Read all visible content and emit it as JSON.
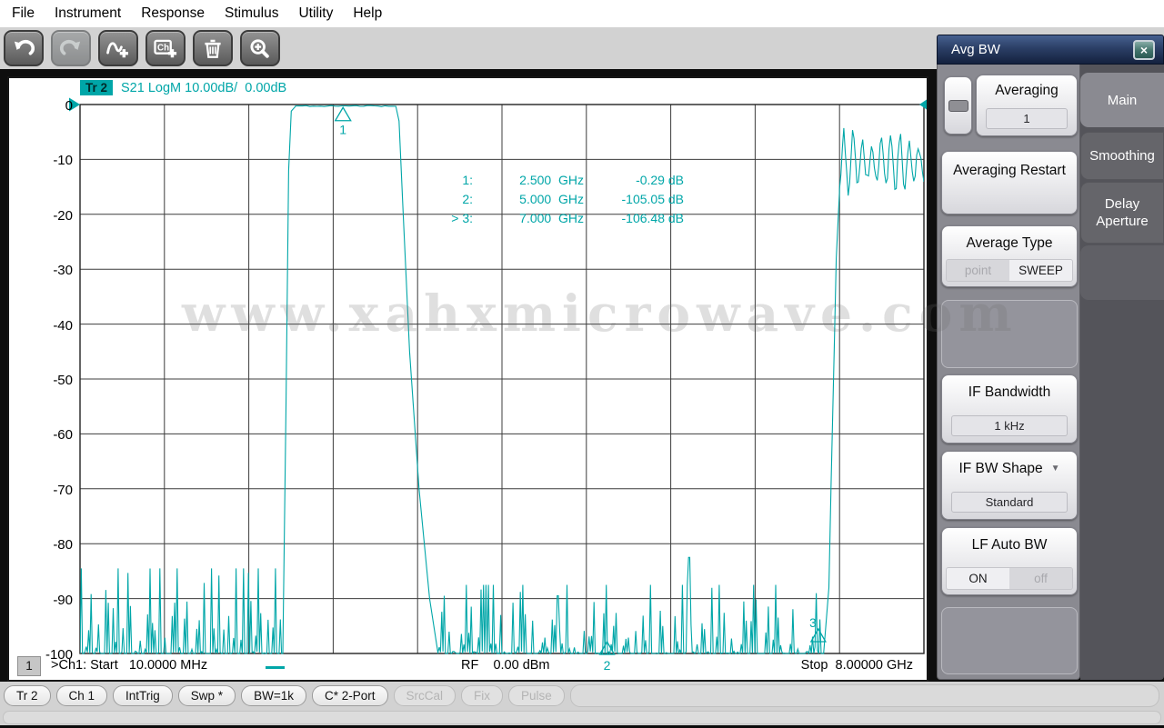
{
  "colors": {
    "trace": "#00A6A8",
    "panel_title_bar": "#2B3F66",
    "panel_body": "#8A8A91",
    "tab_unselected": "#65656A",
    "plot_background": "#FFFFFF",
    "app_dark_background": "#0E0E0E",
    "chrome_background": "#D2D2D2"
  },
  "menu": {
    "items": [
      "File",
      "Instrument",
      "Response",
      "Stimulus",
      "Utility",
      "Help"
    ]
  },
  "toolbar": {
    "buttons": [
      {
        "icon": "undo-icon",
        "enabled": true
      },
      {
        "icon": "redo-icon",
        "enabled": false
      },
      {
        "icon": "add-trace-icon",
        "enabled": true
      },
      {
        "icon": "add-channel-icon",
        "enabled": true
      },
      {
        "icon": "delete-icon",
        "enabled": true
      },
      {
        "icon": "zoom-icon",
        "enabled": true
      }
    ]
  },
  "plot": {
    "trace_badge": "Tr 2",
    "trace_title": "S21 LogM 10.00dB/  0.00dB",
    "y_axis_labels": [
      "0",
      "-10",
      "-20",
      "-30",
      "-40",
      "-50",
      "-60",
      "-70",
      "-80",
      "-90",
      "-100"
    ],
    "marker_rows": [
      {
        "id": "1:",
        "freq": "2.500  GHz",
        "value": "-0.29 dB"
      },
      {
        "id": "2:",
        "freq": "5.000  GHz",
        "value": "-105.05 dB"
      },
      {
        "id": "> 3:",
        "freq": "7.000  GHz",
        "value": "-106.48 dB"
      }
    ],
    "footer": {
      "channel_badge": "1",
      "start": ">Ch1: Start   10.0000 MHz",
      "rf": "RF    0.00 dBm",
      "stop": "Stop  8.00000 GHz"
    },
    "watermark": "www.xahxmicrowave.com"
  },
  "chart_data": {
    "type": "line",
    "title": "S21 LogM bandpass filter response",
    "x_unit": "GHz",
    "y_unit": "dB",
    "x_range": [
      0.01,
      8.0
    ],
    "y_range": [
      -100,
      0
    ],
    "x_divisions": 10,
    "y_divisions": 10,
    "scale_per_division_db": 10.0,
    "reference_level_db": 0.0,
    "markers": [
      {
        "id": "1",
        "freq_ghz": 2.5,
        "value_db": -0.29,
        "active": false
      },
      {
        "id": "2",
        "freq_ghz": 5.0,
        "value_db": -105.05,
        "active": false
      },
      {
        "id": "3",
        "freq_ghz": 7.0,
        "value_db": -106.48,
        "active": true
      }
    ],
    "trace": {
      "name": "S21",
      "segments": [
        {
          "type": "noise",
          "f0": 0.01,
          "f1": 1.93,
          "base_db": -100.8,
          "spike_db": -86
        },
        {
          "type": "edge",
          "points": [
            [
              1.93,
              -100
            ],
            [
              1.96,
              -55
            ],
            [
              1.985,
              -12
            ],
            [
              2.01,
              -1.2
            ],
            [
              2.05,
              -0.35
            ]
          ]
        },
        {
          "type": "flat",
          "f0": 2.05,
          "f1": 3.0,
          "db": -0.29,
          "ripple_db": 0.2
        },
        {
          "type": "edge",
          "points": [
            [
              3.0,
              -0.35
            ],
            [
              3.03,
              -3
            ],
            [
              3.07,
              -20
            ],
            [
              3.13,
              -45
            ],
            [
              3.22,
              -70
            ],
            [
              3.32,
              -90
            ],
            [
              3.4,
              -100
            ]
          ]
        },
        {
          "type": "noise",
          "f0": 3.4,
          "f1": 7.05,
          "base_db": -100.8,
          "spike_db": -89,
          "spurs": [
            {
              "f": 5.78,
              "db": -82.5
            },
            {
              "f": 4.53,
              "db": -89.5
            },
            {
              "f": 6.98,
              "db": -89
            }
          ]
        },
        {
          "type": "edge",
          "points": [
            [
              7.05,
              -100
            ],
            [
              7.1,
              -88
            ],
            [
              7.12,
              -70
            ],
            [
              7.15,
              -45
            ],
            [
              7.17,
              -28
            ],
            [
              7.2,
              -16
            ]
          ]
        },
        {
          "type": "ripple",
          "f0": 7.2,
          "f1": 8.0,
          "mid_db": -10.5,
          "amp_db": 5.2,
          "cycles": 9
        }
      ]
    }
  },
  "panel": {
    "title": "Avg BW",
    "close_icon": "×",
    "tabs": [
      {
        "label": "Main",
        "selected": true
      },
      {
        "label": "Smoothing",
        "selected": false
      },
      {
        "label": "Delay Aperture",
        "selected": false
      }
    ],
    "averaging": {
      "label": "Averaging",
      "value": "1"
    },
    "averaging_restart_label": "Averaging Restart",
    "average_type": {
      "label": "Average Type",
      "options": [
        "point",
        "SWEEP"
      ],
      "selected": "SWEEP"
    },
    "if_bandwidth": {
      "label": "IF Bandwidth",
      "value": "1 kHz"
    },
    "if_bw_shape": {
      "label": "IF BW Shape",
      "value": "Standard",
      "dropdown_icon": "▼"
    },
    "lf_auto_bw": {
      "label": "LF Auto BW",
      "options": [
        "ON",
        "off"
      ],
      "selected": "ON"
    }
  },
  "statusbar": {
    "buttons": [
      {
        "label": "Tr 2",
        "enabled": true
      },
      {
        "label": "Ch 1",
        "enabled": true
      },
      {
        "label": "IntTrig",
        "enabled": true
      },
      {
        "label": "Swp *",
        "enabled": true
      },
      {
        "label": "BW=1k",
        "enabled": true
      },
      {
        "label": "C* 2-Port",
        "enabled": true
      },
      {
        "label": "SrcCal",
        "enabled": false
      },
      {
        "label": "Fix",
        "enabled": false
      },
      {
        "label": "Pulse",
        "enabled": false
      }
    ]
  }
}
